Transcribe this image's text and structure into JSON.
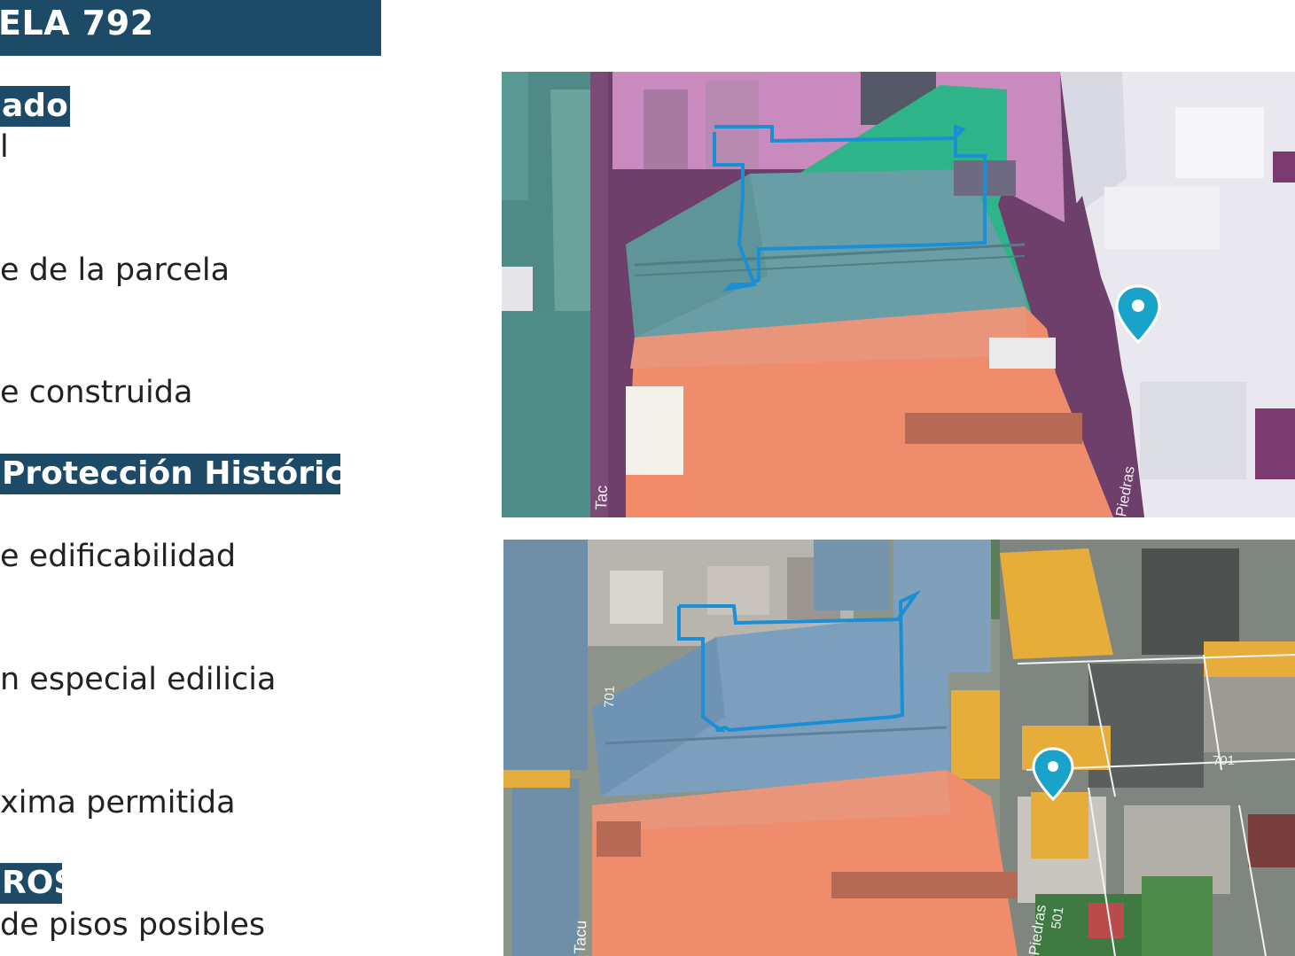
{
  "title": "ELA 792",
  "left_panel": {
    "section1_label": "ado",
    "section1_value": "l",
    "field_area_parcela": "e de la parcela",
    "field_area_construida": "e construida",
    "section2_label": "Protección Histórica",
    "field_edificabilidad": "e edificabilidad",
    "field_especial": "n especial edilicia",
    "field_maxima": "xima permitida",
    "section3_label": "ROS",
    "field_pisos": "de pisos posibles"
  },
  "map_top": {
    "street_left": "Tac",
    "street_right": "Piedras",
    "colors": {
      "teal": "#3f8e8a",
      "salmon": "#ee8c6b",
      "pink": "#c98bbd",
      "green": "#2fb388",
      "white_blocks": "#e8e8ee",
      "outline": "#1a8fd6",
      "marker": "#1aa3c8"
    }
  },
  "map_bottom": {
    "street_left": "Tacu",
    "street_right": "Piedras",
    "label_701_a": "701",
    "label_701_b": "701",
    "label_501": "501",
    "colors": {
      "blue": "#6f9ab6",
      "salmon": "#ee8c6b",
      "yellow": "#e6ad3b",
      "outline": "#1a8fd6",
      "marker": "#1aa3c8"
    }
  }
}
